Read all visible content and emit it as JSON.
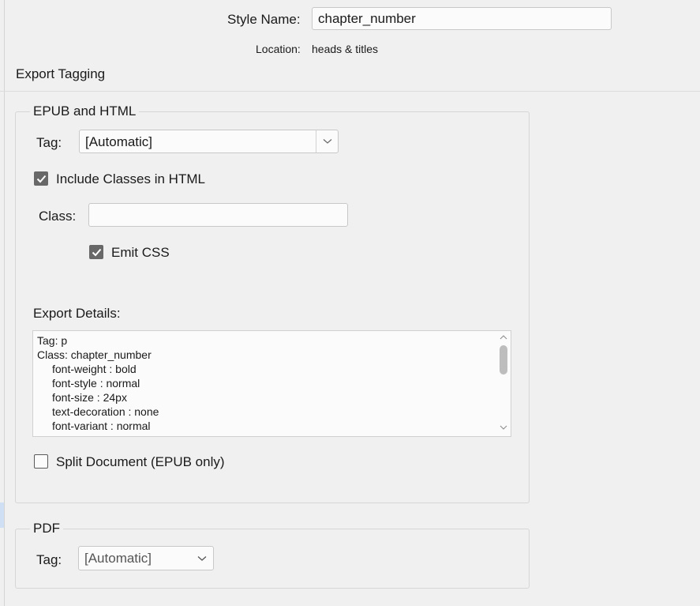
{
  "header": {
    "style_name_label": "Style Name:",
    "style_name_value": "chapter_number",
    "location_label": "Location:",
    "location_value": "heads & titles"
  },
  "section": {
    "title": "Export Tagging"
  },
  "epub_html": {
    "legend": "EPUB and HTML",
    "tag_label": "Tag:",
    "tag_value": "[Automatic]",
    "include_classes_label": "Include Classes in HTML",
    "include_classes_checked": true,
    "class_label": "Class:",
    "class_value": "",
    "emit_css_label": "Emit CSS",
    "emit_css_checked": true,
    "export_details_label": "Export Details:",
    "export_details_lines": [
      "Tag: p",
      "Class: chapter_number",
      "font-weight : bold",
      "font-style : normal",
      "font-size : 24px",
      "text-decoration : none",
      "font-variant : normal"
    ],
    "split_document_label": "Split Document (EPUB only)",
    "split_document_checked": false
  },
  "pdf": {
    "legend": "PDF",
    "tag_label": "Tag:",
    "tag_value": "[Automatic]"
  },
  "icons": {
    "dropdown": "chevron-down-icon",
    "checkmark": "checkmark-icon",
    "scroll_up": "scroll-up-arrow-icon",
    "scroll_down": "scroll-down-arrow-icon"
  },
  "colors": {
    "background": "#f0f0f0",
    "checkbox_checked": "#686868",
    "input_background": "#fbfbfb",
    "border": "#c8c8c8"
  }
}
